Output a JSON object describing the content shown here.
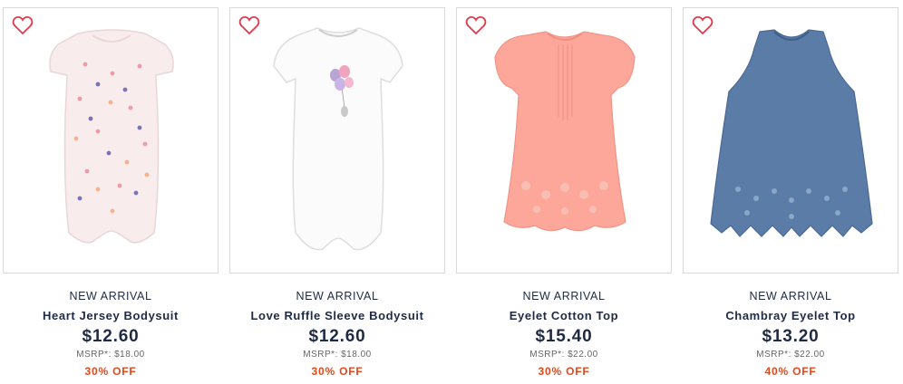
{
  "products": [
    {
      "badge": "NEW ARRIVAL",
      "name": "Heart Jersey Bodysuit",
      "price": "$12.60",
      "msrp_label": "MSRP*:",
      "msrp": "$18.00",
      "discount": "30% OFF",
      "image": "pink-heart-bodysuit"
    },
    {
      "badge": "NEW ARRIVAL",
      "name": "Love Ruffle Sleeve Bodysuit",
      "price": "$12.60",
      "msrp_label": "MSRP*:",
      "msrp": "$18.00",
      "discount": "30% OFF",
      "image": "white-balloon-bodysuit"
    },
    {
      "badge": "NEW ARRIVAL",
      "name": "Eyelet Cotton Top",
      "price": "$15.40",
      "msrp_label": "MSRP*:",
      "msrp": "$22.00",
      "discount": "30% OFF",
      "image": "coral-eyelet-top"
    },
    {
      "badge": "NEW ARRIVAL",
      "name": "Chambray Eyelet Top",
      "price": "$13.20",
      "msrp_label": "MSRP*:",
      "msrp": "$22.00",
      "discount": "40% OFF",
      "image": "chambray-eyelet-top"
    }
  ],
  "colors": {
    "text": "#1f2a44",
    "discount": "#e4481c",
    "heart": "#e0394a",
    "border": "#d9d9d9"
  },
  "icons": {
    "favorite": "heart-outline-icon"
  }
}
